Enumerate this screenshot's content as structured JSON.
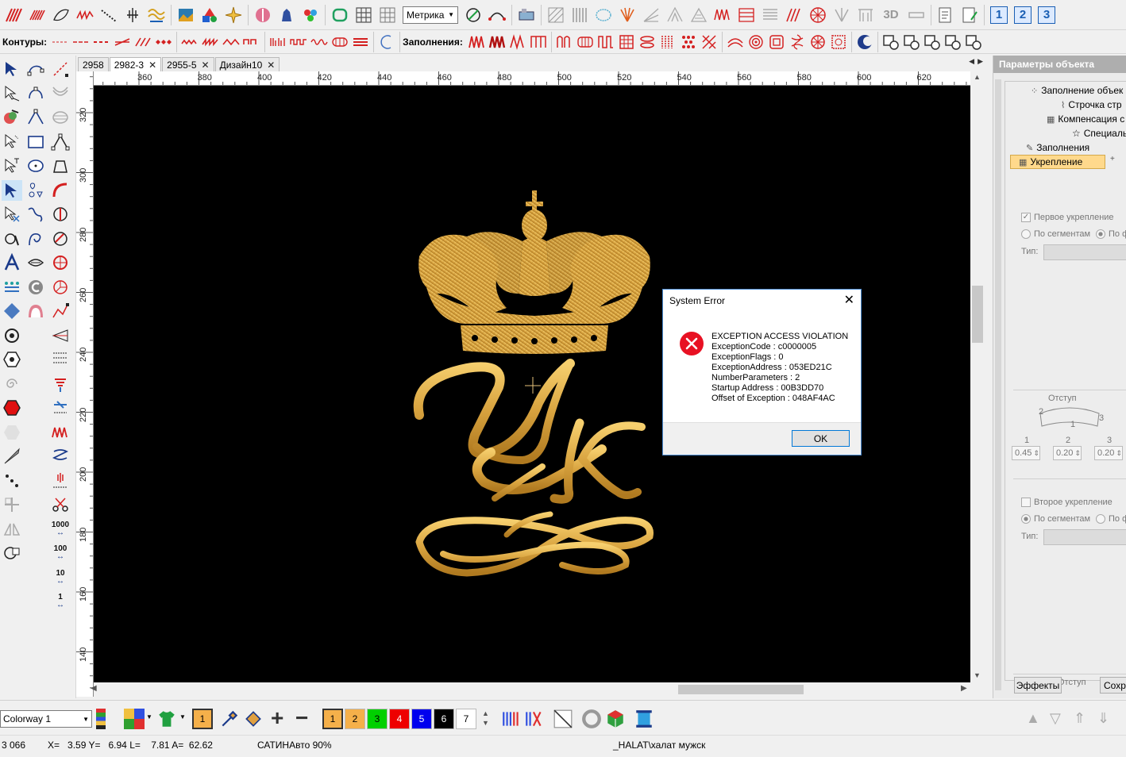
{
  "toolbar": {
    "units_select": "Метрика",
    "label_3d": "3D",
    "num_1": "1",
    "num_2": "2",
    "num_3": "3"
  },
  "toolbar2": {
    "contours_label": "Контуры:",
    "fills_label": "Заполнения:"
  },
  "tools": {
    "num_1000": "1000",
    "num_100": "100",
    "num_10": "10",
    "num_1": "1"
  },
  "tabs": [
    {
      "label": "2958"
    },
    {
      "label": "2982-3",
      "active": true
    },
    {
      "label": "2955-5"
    },
    {
      "label": "Дизайн10"
    }
  ],
  "rulers": {
    "top": [
      "360",
      "380",
      "400",
      "420",
      "440",
      "460",
      "480",
      "500",
      "520",
      "540",
      "560",
      "580",
      "600",
      "620"
    ],
    "left": [
      "320",
      "300",
      "280",
      "260",
      "240",
      "220",
      "200",
      "180",
      "160",
      "140"
    ]
  },
  "dialog": {
    "title": "System Error",
    "lines": [
      "EXCEPTION ACCESS VIOLATION",
      "ExceptionCode : c0000005",
      "ExceptionFlags : 0",
      "ExceptionAddress : 053ED21C",
      "NumberParameters : 2",
      "Startup Address : 00B3DD70",
      "Offset of Exception : 048AF4AC"
    ],
    "ok_label": "OK"
  },
  "panel": {
    "title": "Параметры объекта",
    "items": [
      "Заполнение объек",
      "Строчка стр",
      "Компенсация с",
      "Специаль",
      "Заполнения",
      "Укрепление"
    ],
    "first_reinforce": "Первое укрепление",
    "by_segments": "По сегментам",
    "by_form": "По ф",
    "type_label": "Тип:",
    "indent_label": "Отступ",
    "indent_nums": [
      "1",
      "2",
      "3"
    ],
    "diag_nums": [
      "2",
      "1",
      "3"
    ],
    "indent_values": [
      "0.45",
      "0.20",
      "0.20"
    ],
    "second_reinforce": "Второе укрепление",
    "indent_bottom": "Отступ",
    "effects_btn": "Эффекты",
    "save_btn": "Сохра"
  },
  "bottom": {
    "colorway": "Colorway 1",
    "one": "1",
    "swatches": [
      {
        "label": "1",
        "color": "#f5b04a"
      },
      {
        "label": "2",
        "color": "#f5b04a"
      },
      {
        "label": "3",
        "color": "#00d000"
      },
      {
        "label": "4",
        "color": "#ee0000"
      },
      {
        "label": "5",
        "color": "#0000ee"
      },
      {
        "label": "6",
        "color": "#000000"
      },
      {
        "label": "7",
        "color": "#ffffff"
      }
    ]
  },
  "status": {
    "count": "3 066",
    "coords": "X=   3.59 Y=   6.94 L=    7.81 A=  62.62",
    "mode": "САТИНАвто 90%",
    "path": "_HALAT\\халат мужск"
  },
  "colors": {
    "gold": "#d9a440",
    "canvas": "#000000",
    "error_red": "#e81123"
  }
}
